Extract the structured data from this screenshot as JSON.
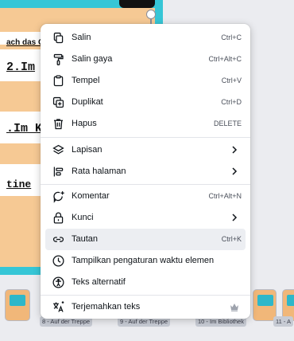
{
  "slide": {
    "texts": [
      "ach das Q",
      "2.Im",
      ".Im Kl",
      "tine"
    ]
  },
  "pages": [
    {
      "label": "8 - Auf der Treppe"
    },
    {
      "label": "9 - Auf der Treppe"
    },
    {
      "label": "10 - Im Bibliothek"
    },
    {
      "label": "11 - A"
    }
  ],
  "menu": {
    "items": [
      {
        "icon": "copy-icon",
        "label": "Salin",
        "shortcut": "Ctrl+C"
      },
      {
        "icon": "paint-roller-icon",
        "label": "Salin gaya",
        "shortcut": "Ctrl+Alt+C"
      },
      {
        "icon": "clipboard-icon",
        "label": "Tempel",
        "shortcut": "Ctrl+V"
      },
      {
        "icon": "duplicate-icon",
        "label": "Duplikat",
        "shortcut": "Ctrl+D"
      },
      {
        "icon": "trash-icon",
        "label": "Hapus",
        "shortcut": "DELETE"
      },
      {
        "icon": "layers-icon",
        "label": "Lapisan",
        "submenu": true
      },
      {
        "icon": "align-icon",
        "label": "Rata halaman",
        "submenu": true
      },
      {
        "icon": "comment-icon",
        "label": "Komentar",
        "shortcut": "Ctrl+Alt+N"
      },
      {
        "icon": "lock-icon",
        "label": "Kunci",
        "submenu": true
      },
      {
        "icon": "link-icon",
        "label": "Tautan",
        "shortcut": "Ctrl+K",
        "hovered": true
      },
      {
        "icon": "timer-icon",
        "label": "Tampilkan pengaturan waktu elemen"
      },
      {
        "icon": "accessibility-icon",
        "label": "Teks alternatif"
      },
      {
        "icon": "translate-icon",
        "label": "Terjemahkan teks",
        "premium": true
      }
    ]
  },
  "colors": {
    "canvas": "#36c6d6",
    "slide": "#f6c994",
    "menu_bg": "#ffffff",
    "hover": "#eceef2"
  }
}
